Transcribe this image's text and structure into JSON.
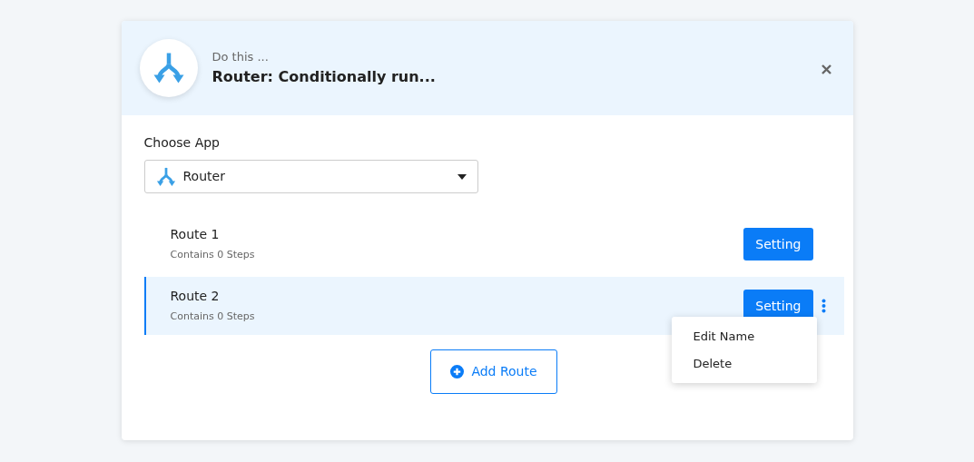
{
  "header": {
    "subtitle": "Do this ...",
    "title": "Router: Conditionally run..."
  },
  "choose_app": {
    "label": "Choose App",
    "value": "Router"
  },
  "routes": [
    {
      "name": "Route 1",
      "steps": "Contains 0 Steps",
      "button": "Setting",
      "selected": false
    },
    {
      "name": "Route 2",
      "steps": "Contains 0 Steps",
      "button": "Setting",
      "selected": true
    }
  ],
  "route_menu": {
    "items": [
      "Edit Name",
      "Delete"
    ]
  },
  "add_button": "Add Route"
}
